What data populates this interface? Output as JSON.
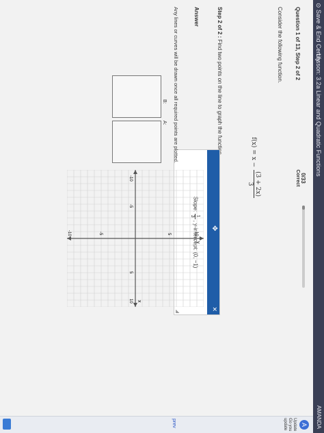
{
  "topbar": {
    "save": "⊙ Save & End Certify",
    "lesson": "Lesson: 3.2a Linear and Quadratic Functions",
    "user": "AMANDA"
  },
  "question": {
    "label": "Question 1 of 13, Step 2 of 2",
    "score": "0/33",
    "score_status": "Correct",
    "progress": 0.05
  },
  "problem": {
    "consider": "Consider the following function.",
    "lhs": "f(x) = x −",
    "numerator": "(3 + 2x)",
    "denominator": "3",
    "step_bold": "Step 2 of 2 :",
    "step_text": "Find two points on the line to graph the function."
  },
  "answer": {
    "label": "Answer",
    "note": "Any lines or curves will be drawn once all required points are plotted.",
    "point_a": "A:",
    "point_b": "B:"
  },
  "hint": {
    "slope_label": "Slope:",
    "slope_num": "1",
    "slope_den": "3",
    "intercept": ", y-intercept: (0, −1)"
  },
  "graph": {
    "x_axis": "x",
    "y_axis": "y",
    "ticks": [
      "-10",
      "-5",
      "5",
      "10"
    ]
  },
  "sidebar": {
    "update_icon": "A",
    "update_text": "Update Go you update",
    "prev": "prev"
  },
  "colors": {
    "accent": "#1f5da8",
    "topbar": "#3a3f55"
  }
}
